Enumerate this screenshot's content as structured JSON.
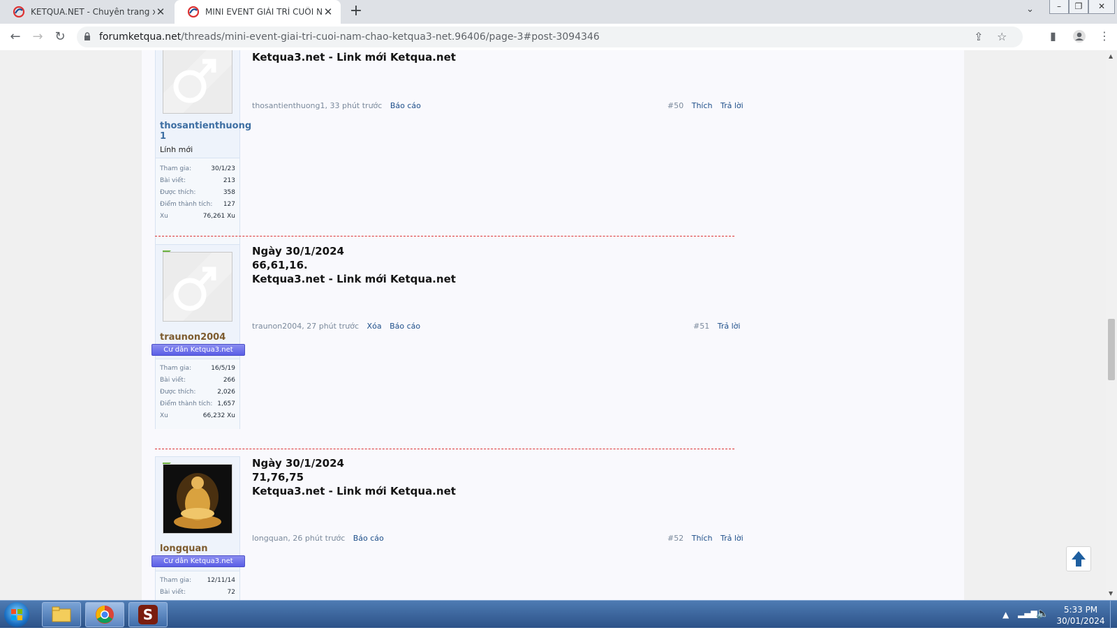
{
  "browser": {
    "tabs": [
      {
        "title": "KETQUA.NET - Chuyên trang xổ số",
        "active": false
      },
      {
        "title": "MINI EVENT GIẢI TRÍ CUỐI NĂM",
        "active": true
      }
    ],
    "url_domain": "forumketqua.net",
    "url_path": "/threads/mini-event-giai-tri-cuoi-nam-chao-ketqua3-net.96406/page-3#post-3094346"
  },
  "posts": [
    {
      "number": "#50",
      "lines": [
        "Ketqua3.net - Link mới Ketqua.net"
      ],
      "author": "thosantienthuong1",
      "username_display": "thosantienthuong 1",
      "user_title": "Lính mới",
      "ribbon": "",
      "time": "33 phút trước",
      "actions_left": [
        "Báo cáo"
      ],
      "actions_right": [
        "Thích",
        "Trả lời"
      ],
      "stats": [
        {
          "label": "Tham gia:",
          "value": "30/1/23"
        },
        {
          "label": "Bài viết:",
          "value": "213"
        },
        {
          "label": "Được thích:",
          "value": "358"
        },
        {
          "label": "Điểm thành tích:",
          "value": "127"
        },
        {
          "label": "Xu",
          "value": "76,261 Xu"
        }
      ]
    },
    {
      "number": "#51",
      "lines": [
        "Ngày 30/1/2024",
        "66,61,16.",
        "Ketqua3.net - Link mới Ketqua.net"
      ],
      "author": "traunon2004",
      "username_display": "traunon2004",
      "user_title": "",
      "ribbon": "Cư dân Ketqua3.net",
      "time": "27 phút trước",
      "actions_left": [
        "Xóa",
        "Báo cáo"
      ],
      "actions_right": [
        "Trả lời"
      ],
      "stats": [
        {
          "label": "Tham gia:",
          "value": "16/5/19"
        },
        {
          "label": "Bài viết:",
          "value": "266"
        },
        {
          "label": "Được thích:",
          "value": "2,026"
        },
        {
          "label": "Điểm thành tích:",
          "value": "1,657"
        },
        {
          "label": "Xu",
          "value": "66,232 Xu"
        }
      ]
    },
    {
      "number": "#52",
      "lines": [
        "Ngày 30/1/2024",
        "71,76,75",
        "Ketqua3.net - Link mới Ketqua.net"
      ],
      "author": "longquan",
      "username_display": "longquan",
      "user_title": "",
      "ribbon": "Cư dân Ketqua3.net",
      "time": "26 phút trước",
      "actions_left": [
        "Báo cáo"
      ],
      "actions_right": [
        "Thích",
        "Trả lời"
      ],
      "stats": [
        {
          "label": "Tham gia:",
          "value": "12/11/14"
        },
        {
          "label": "Bài viết:",
          "value": "72"
        }
      ]
    }
  ],
  "taskbar": {
    "time": "5:33 PM",
    "date": "30/01/2024"
  },
  "colors": {
    "link": "#1e4f8a",
    "ribbon": "#5a5ee6",
    "divider": "#dd3333"
  }
}
